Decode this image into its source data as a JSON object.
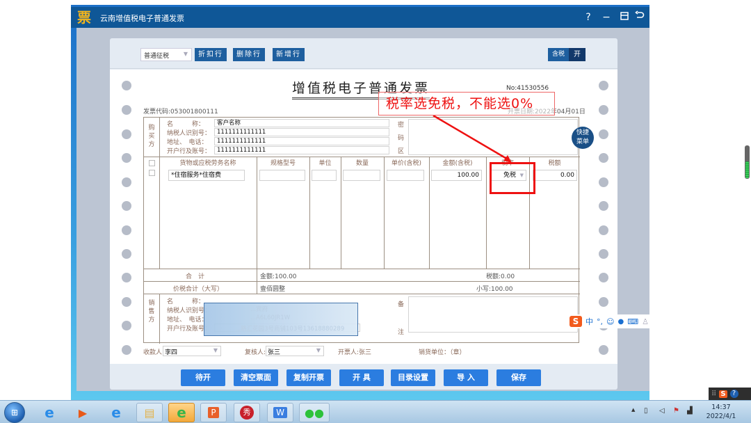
{
  "window": {
    "logo_glyph": "票",
    "title": "云南增值税电子普通发票",
    "controls": {
      "help": "?",
      "minimize": "−",
      "restore": "⊟",
      "back": "↺"
    }
  },
  "toolbar": {
    "tax_type": "普通征税",
    "buttons": [
      "折扣行",
      "删除行",
      "新增行"
    ],
    "tax_included_label": "含税",
    "tax_included_value": "开"
  },
  "invoice": {
    "title": "增值税电子普通发票",
    "number": "No:41530556",
    "code": "发票代码:053001800111",
    "date": "开票日期:2022年04月01日",
    "buyer": {
      "side_label": "购买方",
      "fields": [
        {
          "label": "名　　　称：",
          "value": "客户名称"
        },
        {
          "label": "纳税人识别号：",
          "value": "1111111111111"
        },
        {
          "label": "地址、　电话：",
          "value": "1111111111111"
        },
        {
          "label": "开户行及账号：",
          "value": "1111111111111"
        }
      ],
      "cipher_label": [
        "密",
        "码",
        "区"
      ]
    },
    "columns": [
      "货物或应税劳务名称",
      "规格型号",
      "单位",
      "数量",
      "单价(含税)",
      "金额(含税)",
      "税率",
      "税额"
    ],
    "rows": [
      {
        "name": "*住宿服务*住宿费",
        "spec": "",
        "unit": "",
        "qty": "",
        "price": "",
        "amount": "100.00",
        "rate": "免税",
        "tax": "0.00"
      }
    ],
    "totals": {
      "label": "合　计",
      "amount": "金额:100.00",
      "tax": "税额:0.00",
      "grand_label": "价税合计（大写）",
      "grand_words": "壹佰圆整",
      "grand_small": "小写:100.00"
    },
    "seller": {
      "side_label": "销售方",
      "fields": [
        {
          "label": "名　　　称："
        },
        {
          "label": "纳税人识别号："
        },
        {
          "label": "地址、　电话："
        },
        {
          "label": "开户行及账号："
        }
      ],
      "obscured_lines": [
        "...宾府",
        "...A6L60JR1W",
        "...路汇花园3号商铺103号13618880289"
      ],
      "remark_label": [
        "备",
        "注"
      ]
    },
    "signers": {
      "payee_label": "收款人:",
      "payee": "李四",
      "reviewer_label": "复核人:",
      "reviewer": "张三",
      "issuer": "开票人:张三",
      "seller_unit": "销货单位：（章）"
    }
  },
  "annotation": {
    "text": "税率选免税，不能选0%",
    "color": "#ee1111"
  },
  "quick_menu": "快捷菜单",
  "bottom_buttons": [
    "待开",
    "清空票面",
    "复制开票",
    "开 具",
    "目录设置",
    "导 入",
    "保存"
  ],
  "ime": {
    "logo": "S",
    "mode": "中",
    "punct": "°,",
    "emoji": "☺",
    "mic": "🎤",
    "keyboard": "⌨",
    "user": "👤"
  },
  "taskbar": {
    "apps": [
      "start",
      "ie-pinned",
      "media-player",
      "internet-explorer",
      "file-explorer",
      "360-browser",
      "wps-presentation",
      "meitu",
      "wps-writer",
      "wechat"
    ],
    "clock_time": "14:37",
    "clock_date": "2022/4/1"
  },
  "colors": {
    "title_bar": "#0f5797",
    "toolbar_button": "#1e5f9f",
    "action_button": "#2b7de0",
    "annotation": "#ee1111"
  }
}
